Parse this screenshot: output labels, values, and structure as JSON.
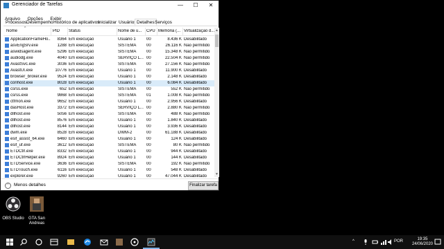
{
  "window": {
    "title": "Gerenciador de Tarefas",
    "minimize": "—",
    "maximize": "☐",
    "close": "✕"
  },
  "menu": [
    "Arquivo",
    "Opções",
    "Exibir"
  ],
  "tabs": [
    {
      "label": "Processos",
      "active": false
    },
    {
      "label": "Desempenho",
      "active": false
    },
    {
      "label": "Histórico de aplicativos",
      "active": false
    },
    {
      "label": "Inicializar",
      "active": false
    },
    {
      "label": "Usuários",
      "active": false
    },
    {
      "label": "Detalhes",
      "active": true
    },
    {
      "label": "Serviços",
      "active": false
    }
  ],
  "columns": [
    "Nome",
    "PID",
    "Status",
    "Nome de u...",
    "CPU",
    "Memória (...",
    "Virtualização d..."
  ],
  "processes": [
    [
      "ApplicationFrameHo...",
      "8364",
      "Em execução",
      "Usuário 1",
      "00",
      "8.436 K",
      "Desabilitado"
    ],
    [
      "asvEngSrv.exe",
      "1288",
      "Em execução",
      "SISTEMA",
      "00",
      "26.116 K",
      "Não permitido"
    ],
    [
      "aswidsagent.exe",
      "5296",
      "Em execução",
      "SISTEMA",
      "00",
      "15.348 K",
      "Não permitido"
    ],
    [
      "audiodg.exe",
      "4040",
      "Em execução",
      "SERVIÇO L...",
      "00",
      "22.504 K",
      "Não permitido"
    ],
    [
      "AvastSvc.exe",
      "3036",
      "Em execução",
      "SISTEMA",
      "00",
      "27.156 K",
      "Não permitido"
    ],
    [
      "AvastUI.exe",
      "10776",
      "Em execução",
      "Usuário 1",
      "00",
      "11.900 K",
      "Desabilitado"
    ],
    [
      "browser_broker.exe",
      "9524",
      "Em execução",
      "Usuário 1",
      "00",
      "2.148 K",
      "Desabilitado"
    ],
    [
      "conhost.exe",
      "8028",
      "Em execução",
      "Usuário 1",
      "00",
      "6.084 K",
      "Desabilitado"
    ],
    [
      "csrss.exe",
      "652",
      "Em execução",
      "SISTEMA",
      "00",
      "552 K",
      "Não permitido"
    ],
    [
      "csrss.exe",
      "9868",
      "Em execução",
      "SISTEMA",
      "01",
      "1.008 K",
      "Não permitido"
    ],
    [
      "ctfmon.exe",
      "9652",
      "Em execução",
      "Usuário 1",
      "00",
      "2.956 K",
      "Desabilitado"
    ],
    [
      "dasHost.exe",
      "3372",
      "Em execução",
      "SERVIÇO L...",
      "00",
      "2.880 K",
      "Não permitido"
    ],
    [
      "dllhost.exe",
      "5056",
      "Em execução",
      "SISTEMA",
      "00",
      "488 K",
      "Não permitido"
    ],
    [
      "dllhost.exe",
      "8576",
      "Em execução",
      "Usuário 1",
      "00",
      "1.840 K",
      "Desabilitado"
    ],
    [
      "dllhost.exe",
      "8144",
      "Em execução",
      "Usuário 1",
      "00",
      "3.936 K",
      "Desabilitado"
    ],
    [
      "dwm.exe",
      "8528",
      "Em execução",
      "DWM-2",
      "00",
      "61.188 K",
      "Desabilitado"
    ],
    [
      "esif_assist_64.exe",
      "6460",
      "Em execução",
      "Usuário 1",
      "00",
      "124 K",
      "Desabilitado"
    ],
    [
      "esif_uf.exe",
      "3612",
      "Em execução",
      "SISTEMA",
      "00",
      "80 K",
      "Não permitido"
    ],
    [
      "ETDCtrl.exe",
      "8332",
      "Em execução",
      "Usuário 1",
      "00",
      "944 K",
      "Desabilitado"
    ],
    [
      "ETDCtrlHelper.exe",
      "8924",
      "Em execução",
      "Usuário 1",
      "00",
      "144 K",
      "Desabilitado"
    ],
    [
      "ETDService.exe",
      "3636",
      "Em execução",
      "SISTEMA",
      "00",
      "192 K",
      "Não permitido"
    ],
    [
      "ETDTouch.exe",
      "6116",
      "Em execução",
      "Usuário 1",
      "00",
      "548 K",
      "Desabilitado"
    ],
    [
      "explorer.exe",
      "9260",
      "Em execução",
      "Usuário 1",
      "00",
      "47.044 K",
      "Desabilitado"
    ]
  ],
  "selected_row": 7,
  "footer": {
    "less_details": "Menos detalhes",
    "end_task": "Finalizar tarefa"
  },
  "desktop_icons": [
    {
      "label": "OBS Studio",
      "icon": "obs-icon"
    },
    {
      "label": "GTA San Andreas",
      "icon": "gta-icon"
    }
  ],
  "taskbar": {
    "icons": [
      "start-icon",
      "search-icon",
      "task-view-icon",
      "file-explorer-icon",
      "edge-icon",
      "mail-icon",
      "gta-icon",
      "obs-icon",
      "task-manager-icon"
    ],
    "tray_lang": "POR",
    "time": "19:35",
    "date": "24/06/2020"
  }
}
